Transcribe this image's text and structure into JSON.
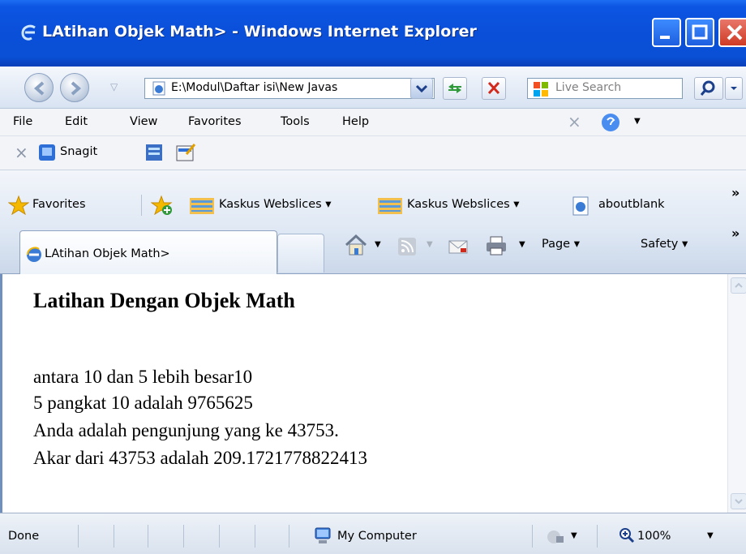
{
  "window": {
    "title": "LAtihan Objek Math> - Windows Internet Explorer"
  },
  "addressbar": {
    "url": "E:\\Modul\\Daftar isi\\New Javas",
    "search_placeholder": "Live Search"
  },
  "menu": {
    "items": [
      "File",
      "Edit",
      "View",
      "Favorites",
      "Tools",
      "Help"
    ]
  },
  "toolbar": {
    "snagit_label": "Snagit"
  },
  "favorites_bar": {
    "favorites_label": "Favorites",
    "items": [
      "Kaskus Webslices ▾",
      "Kaskus Webslices ▾",
      "aboutblank"
    ],
    "chevron": "»"
  },
  "tabs": {
    "active_label": "LAtihan Objek Math>"
  },
  "command_bar": {
    "page_label": "Page ▾",
    "safety_label": "Safety ▾",
    "chevron": "»"
  },
  "page": {
    "heading": "Latihan Dengan Objek Math",
    "lines": [
      "antara 10 dan 5 lebih besar10",
      "5 pangkat 10 adalah 9765625",
      "Anda adalah pengunjung yang ke 43753.",
      "Akar dari 43753 adalah 209.1721778822413"
    ]
  },
  "statusbar": {
    "status": "Done",
    "zone": "My Computer",
    "zoom": "100%"
  },
  "colors": {
    "titlebar": "#0a4fd8",
    "close_button": "#cf3b24"
  }
}
